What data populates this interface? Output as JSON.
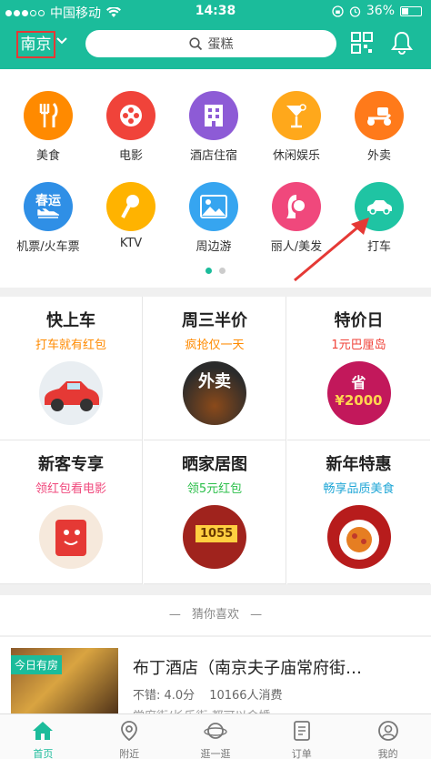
{
  "status_bar": {
    "carrier": "中国移动",
    "time": "14:38",
    "battery": "36%",
    "battery_level": 0.36
  },
  "header": {
    "city": "南京",
    "search_placeholder": "蛋糕"
  },
  "categories": [
    {
      "label": "美食",
      "color": "#ff8a00",
      "icon": "fork-knife-icon"
    },
    {
      "label": "电影",
      "color": "#f0433a",
      "icon": "film-reel-icon"
    },
    {
      "label": "酒店住宿",
      "color": "#8d5bd6",
      "icon": "hotel-building-icon"
    },
    {
      "label": "休闲娱乐",
      "color": "#ffa81b",
      "icon": "cocktail-icon"
    },
    {
      "label": "外卖",
      "color": "#ff7a1a",
      "icon": "scooter-icon"
    },
    {
      "label": "机票/火车票",
      "color": "#2f8fe6",
      "icon": "plane-icon",
      "badge": "春运"
    },
    {
      "label": "KTV",
      "color": "#ffb300",
      "icon": "microphone-icon"
    },
    {
      "label": "周边游",
      "color": "#36a5f0",
      "icon": "landscape-icon"
    },
    {
      "label": "丽人/美发",
      "color": "#f0487c",
      "icon": "woman-icon"
    },
    {
      "label": "打车",
      "color": "#1fc4a3",
      "icon": "car-icon"
    }
  ],
  "promos": [
    {
      "title": "快上车",
      "subtitle": "打车就有红包",
      "sub_color": "#ff8a00"
    },
    {
      "title": "周三半价",
      "subtitle": "疯抢仅一天",
      "sub_color": "#ff8a00",
      "img_text": "外卖"
    },
    {
      "title": "特价日",
      "subtitle": "1元巴厘岛",
      "sub_color": "#f0433a",
      "img_text": "省",
      "img_amount": "¥2000"
    },
    {
      "title": "新客专享",
      "subtitle": "领红包看电影",
      "sub_color": "#f0487c"
    },
    {
      "title": "晒家居图",
      "subtitle": "领5元红包",
      "sub_color": "#2bbf4a",
      "img_text": "1055"
    },
    {
      "title": "新年特惠",
      "subtitle": "畅享品质美食",
      "sub_color": "#1fa6d6"
    }
  ],
  "guess": {
    "title": "猜你喜欢"
  },
  "listing": {
    "badge": "今日有房",
    "title": "布丁酒店（南京夫子庙常府街…",
    "rating": "不错: 4.0分",
    "consumption": "10166人消费",
    "address": "常府街/长乐街 都可以金婚"
  },
  "tabs": [
    {
      "label": "首页",
      "icon": "home-icon",
      "active": true
    },
    {
      "label": "附近",
      "icon": "location-pin-icon"
    },
    {
      "label": "逛一逛",
      "icon": "planet-icon"
    },
    {
      "label": "订单",
      "icon": "order-list-icon"
    },
    {
      "label": "我的",
      "icon": "user-icon"
    }
  ]
}
